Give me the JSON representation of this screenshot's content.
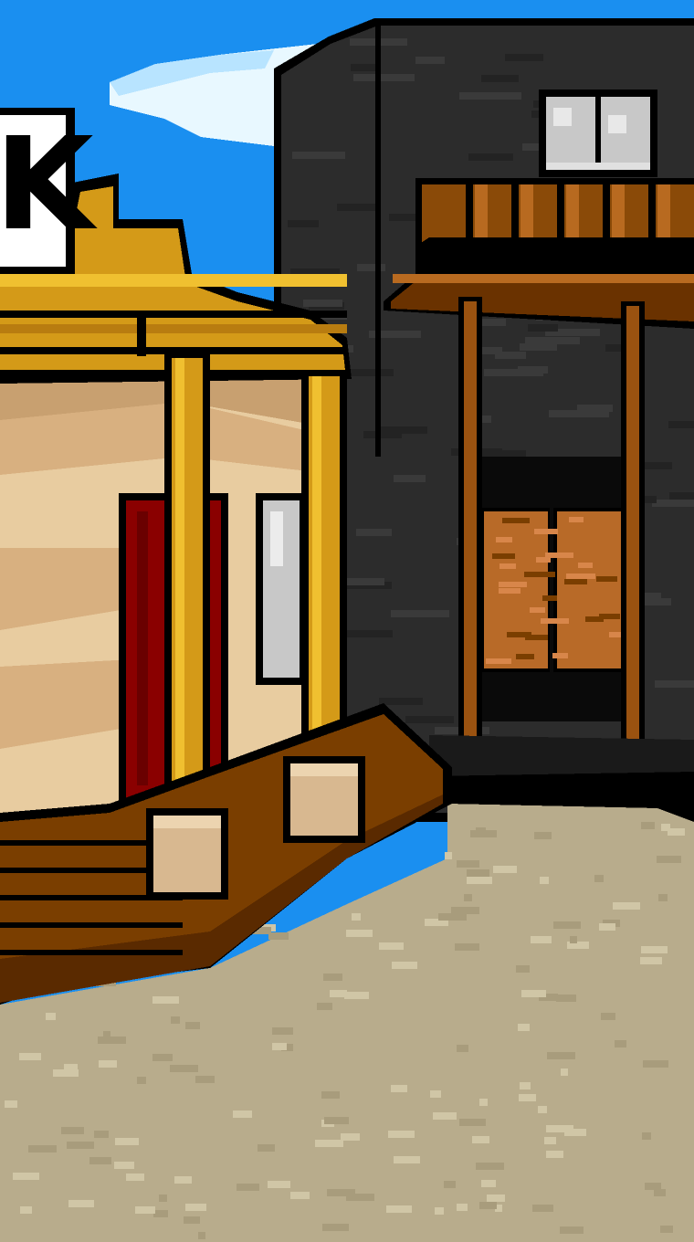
{
  "scene": {
    "name": "western-town-street",
    "colors": {
      "sky": "#1a8ff0",
      "cloud": "#e8f8ff",
      "cloud_shadow": "#b8e4ff",
      "dark_building": "#2c2c2c",
      "dark_brick": "#3a3a3a",
      "outline": "#000000",
      "wood": "#7a3e00",
      "wood_light": "#b86a20",
      "wood_dark": "#5a2a00",
      "gold_trim": "#d49a18",
      "gold_light": "#f0c030",
      "adobe_wall": "#e8cca0",
      "adobe_shade": "#d8b080",
      "red_door": "#8a0000",
      "window_glass": "#c8c8c8",
      "ground": "#b8ac8c",
      "ground_speck": "#d0c6a6",
      "step_base": "#d8b890"
    },
    "sign": {
      "glyph": "K"
    }
  }
}
